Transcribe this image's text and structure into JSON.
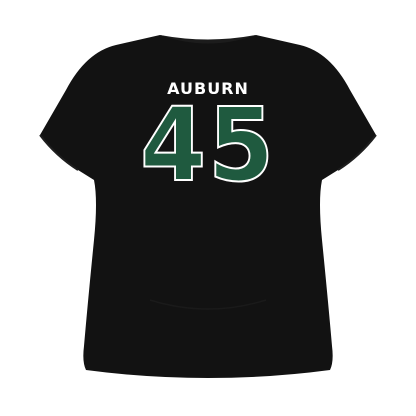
{
  "garment": {
    "player_name": "AUBURN",
    "player_number": "45",
    "colors": {
      "shirt": "#111111",
      "number_fill": "#1f5a3f",
      "number_outline": "#ffffff",
      "name_text": "#ffffff",
      "background": "#ffffff"
    }
  }
}
